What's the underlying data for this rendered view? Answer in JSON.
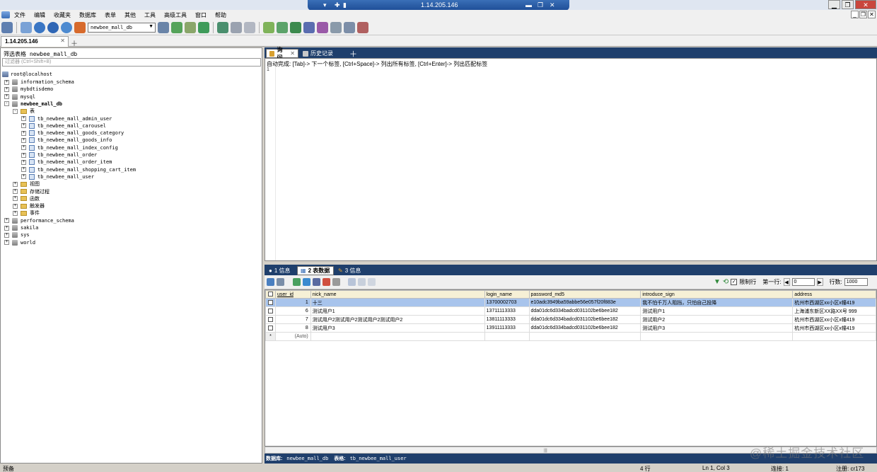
{
  "remote": {
    "title": "1.14.205.146"
  },
  "menubar": {
    "items": [
      "文件",
      "编辑",
      "收藏夹",
      "数据库",
      "表单",
      "其他",
      "工具",
      "高级工具",
      "窗口",
      "帮助"
    ]
  },
  "toolbar": {
    "db_select": "newbee_mall_db"
  },
  "connection_tab": {
    "label": "1.14.205.146"
  },
  "left": {
    "filter_label": "筛选表格 newbee_mall_db",
    "filter_placeholder": "过滤器 (Ctrl+Shift+B)",
    "tree": [
      {
        "label": "root@localhost",
        "kind": "server",
        "level": 0,
        "expand": ""
      },
      {
        "label": "information_schema",
        "kind": "db",
        "level": 1,
        "expand": "+"
      },
      {
        "label": "mybdtisdemo",
        "kind": "db",
        "level": 1,
        "expand": "+"
      },
      {
        "label": "mysql",
        "kind": "db",
        "level": 1,
        "expand": "+"
      },
      {
        "label": "newbee_mall_db",
        "kind": "db",
        "level": 1,
        "expand": "-",
        "bold": true
      },
      {
        "label": "表",
        "kind": "folder",
        "level": 2,
        "expand": "-"
      },
      {
        "label": "tb_newbee_mall_admin_user",
        "kind": "table",
        "level": 3,
        "expand": "+"
      },
      {
        "label": "tb_newbee_mall_carousel",
        "kind": "table",
        "level": 3,
        "expand": "+"
      },
      {
        "label": "tb_newbee_mall_goods_category",
        "kind": "table",
        "level": 3,
        "expand": "+"
      },
      {
        "label": "tb_newbee_mall_goods_info",
        "kind": "table",
        "level": 3,
        "expand": "+"
      },
      {
        "label": "tb_newbee_mall_index_config",
        "kind": "table",
        "level": 3,
        "expand": "+"
      },
      {
        "label": "tb_newbee_mall_order",
        "kind": "table",
        "level": 3,
        "expand": "+"
      },
      {
        "label": "tb_newbee_mall_order_item",
        "kind": "table",
        "level": 3,
        "expand": "+"
      },
      {
        "label": "tb_newbee_mall_shopping_cart_item",
        "kind": "table",
        "level": 3,
        "expand": "+"
      },
      {
        "label": "tb_newbee_mall_user",
        "kind": "table",
        "level": 3,
        "expand": "+"
      },
      {
        "label": "视图",
        "kind": "folder",
        "level": 2,
        "expand": "+"
      },
      {
        "label": "存储过程",
        "kind": "folder",
        "level": 2,
        "expand": "+"
      },
      {
        "label": "函数",
        "kind": "folder",
        "level": 2,
        "expand": "+"
      },
      {
        "label": "触发器",
        "kind": "folder",
        "level": 2,
        "expand": "+"
      },
      {
        "label": "事件",
        "kind": "folder",
        "level": 2,
        "expand": "+"
      },
      {
        "label": "performance_schema",
        "kind": "db",
        "level": 1,
        "expand": "+"
      },
      {
        "label": "sakila",
        "kind": "db",
        "level": 1,
        "expand": "+"
      },
      {
        "label": "sys",
        "kind": "db",
        "level": 1,
        "expand": "+"
      },
      {
        "label": "world",
        "kind": "db",
        "level": 1,
        "expand": "+"
      }
    ]
  },
  "editor": {
    "tabs": {
      "query": "询问",
      "history": "历史记录"
    },
    "hint": "自动完成: [Tab]-> 下一个标签, [Ctrl+Space]-> 列出所有标签, [Ctrl+Enter]-> 列出匹配标签",
    "line_number": "1"
  },
  "results": {
    "tabs": {
      "info": "1 信息",
      "data": "2 表数据",
      "info3": "3 信息"
    },
    "limit": {
      "label": "限制行",
      "first_row_label": "第一行:",
      "first_row_value": "0",
      "rows_label": "行数:",
      "rows_value": "1000"
    },
    "columns": [
      "user_id",
      "nick_name",
      "login_name",
      "password_md5",
      "introduce_sign",
      "address"
    ],
    "rows": [
      [
        "1",
        "十三",
        "13700002703",
        "e10adc3949ba59abbe56e057f20f883e",
        "我不怕千万人阻挡，只怕自己投降",
        "杭州市西湖区xx小区x幢419"
      ],
      [
        "6",
        "测试用户1",
        "13711113333",
        "dda01dc6d334badcd031102be6bee182",
        "测试用户1",
        "上海浦东新区XX路XX号 999"
      ],
      [
        "7",
        "测试用户2测试用户2测试用户2测试用户2",
        "13811113333",
        "dda01dc6d334badcd031102be6bee182",
        "测试用户2",
        "杭州市西湖区xx小区x幢419"
      ],
      [
        "8",
        "测试用户3",
        "13911113333",
        "dda01dc6d334badcd031102be6bee182",
        "测试用户3",
        "杭州市西湖区xx小区x幢419"
      ]
    ],
    "auto_label": "(Auto)",
    "new_row_marker": "*",
    "status": {
      "db_label": "数据库:",
      "db": "newbee_mall_db",
      "table_label": "表格:",
      "table": "tb_newbee_mall_user"
    }
  },
  "statusbar": {
    "ready": "预备",
    "rows": "4 行",
    "position": "Ln 1, Col 3",
    "connections": "连接: 1",
    "user": "注册: cr173"
  },
  "watermark": "@稀土掘金技术社区"
}
